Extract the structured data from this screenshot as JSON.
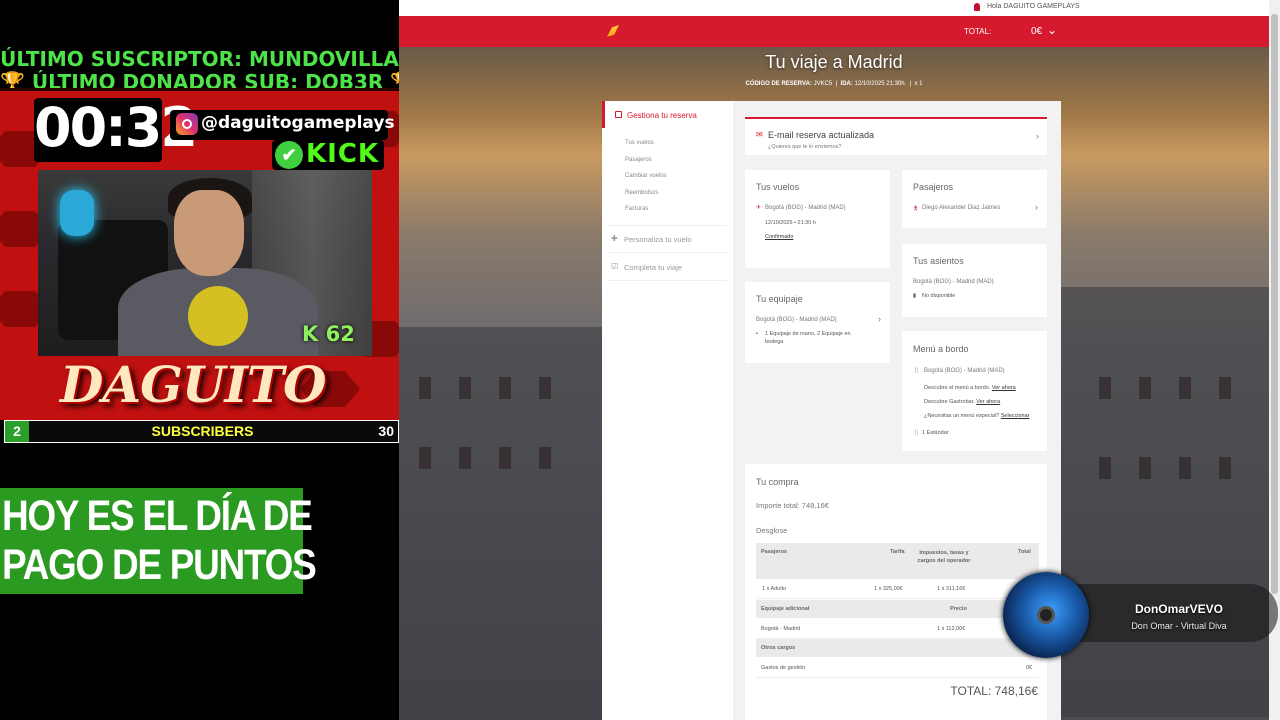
{
  "overlay": {
    "latest_sub": "ÚLTIMO SUSCRIPTOR: MUNDOVILLA",
    "latest_donor": "ÚLTIMO DONADOR SUB: DOB3R",
    "trophy": "🏆",
    "timer": "00:32",
    "instagram_handle": "@daguitogameplays",
    "kick_label": "KICK",
    "kick_check": "✔",
    "k_badge": "K 62",
    "logo_text": "DAGUITO",
    "subscribers": {
      "current": "2",
      "label": "SUBSCRIBERS",
      "goal": "30"
    },
    "promo": [
      "HOY ES EL DÍA DE",
      "PAGO DE PUNTOS"
    ],
    "colors": {
      "green": "#4fe34a",
      "red_frame": "#c01010",
      "promo_bg": "#2a9a20"
    }
  },
  "site": {
    "greeting": "Hola DAGUITO GAMEPLAYS",
    "total_label": "TOTAL:",
    "total_value": "0€",
    "chevron": "⌄",
    "brand_color": "#d7192d",
    "trip_title": "Tu viaje a Madrid",
    "trip_meta": {
      "code_label": "CÓDIGO DE RESERVA:",
      "code": "JVKC5",
      "sep": "|",
      "ida_label": "IDA:",
      "ida": "12/10/2025 21:30h.",
      "pax": "x 1"
    },
    "sidebar": {
      "active": "Gestiona tu reserva",
      "subs": [
        "Tus vuelos",
        "Pasajeros",
        "Cambiar vuelos",
        "Reembolsos",
        "Facturas"
      ],
      "personaliza": "Personaliza tu vuelo",
      "completa": "Completa tu viaje"
    },
    "email_card": {
      "title": "E-mail reserva actualizada",
      "sub": "¿Quieres que te lo enviemos?"
    },
    "vuelos": {
      "title": "Tus vuelos",
      "route": "Bogotá (BOG) - Madrid (MAD)",
      "date": "12/10/2025 • 21:30 h",
      "status": "Confirmado"
    },
    "pasajeros": {
      "title": "Pasajeros",
      "name": "Diego Alexander Diaz Jaimes"
    },
    "asientos": {
      "title": "Tus asientos",
      "route": "Bogotá (BOG) - Madrid (MAD)",
      "status": "No disponible"
    },
    "equipaje": {
      "title": "Tu equipaje",
      "route": "Bogotá (BOG) - Madrid (MAD)",
      "line1": "1 Equipaje de mano, 2 Equipaje en",
      "line2": "bodega"
    },
    "menu": {
      "title": "Menú a bordo",
      "route": "Bogotá (BOG) - Madrid (MAD)",
      "l1": "Descubre el menú a bordo.",
      "l1_link": "Ver ahora",
      "l2": "Descubre Gastrobar.",
      "l2_link": "Ver ahora",
      "l3": "¿Necesitas un menú especial?",
      "l3_link": "Seleccionar",
      "standard": "1 Estándar"
    },
    "compra": {
      "title": "Tu compra",
      "importe": "Importe total: 748,16€",
      "desglose": "Desglose",
      "headers": {
        "pasajeros": "Pasajeros",
        "tarifa": "Tarifa",
        "impuestos": "Impuestos, tasas y cargos del operador",
        "total": "Total"
      },
      "row1": {
        "name": "1 x Adulto",
        "tarifa": "1 x 325,00€",
        "impuestos": "1 x 311,16€"
      },
      "eq_header": {
        "name": "Equipaje adicional",
        "precio": "Precio"
      },
      "row2": {
        "name": "Bogotá · Madrid",
        "precio": "1 x 112,00€"
      },
      "otros": "Otros cargos",
      "row3": {
        "name": "Gastos de gestión",
        "total": "0€"
      },
      "grand_total": "TOTAL: 748,16€"
    }
  },
  "now_playing": {
    "artist": "DonOmarVEVO",
    "song": "Don Omar - Virtual Diva"
  }
}
